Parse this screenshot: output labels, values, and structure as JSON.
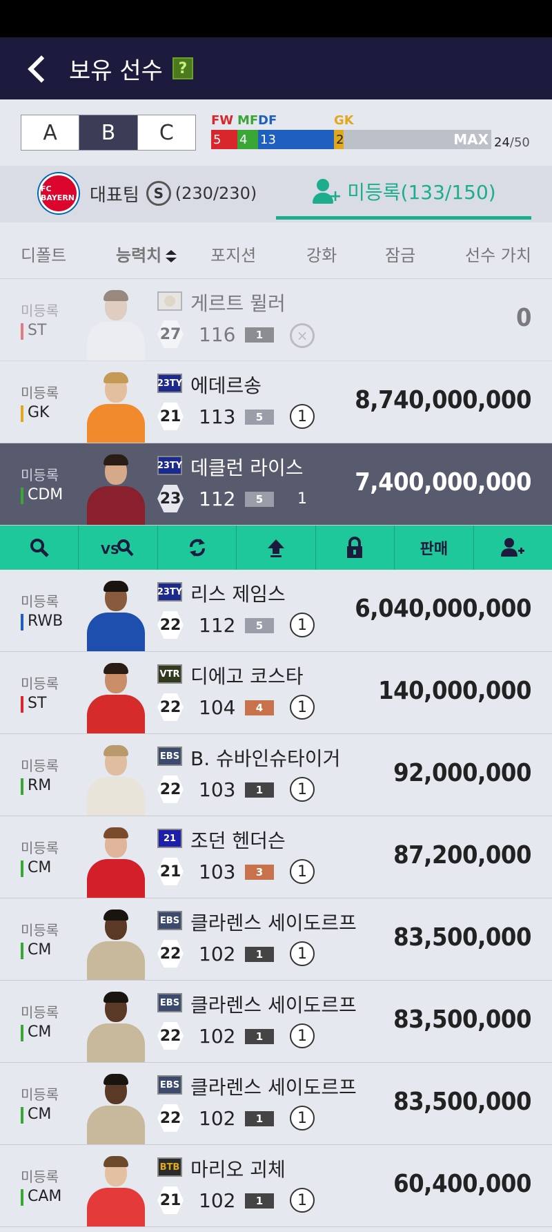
{
  "header": {
    "title": "보유 선수",
    "help": "?"
  },
  "squad_tabs": [
    "A",
    "B",
    "C"
  ],
  "positions": {
    "fw_label": "FW",
    "mf_label": "MF",
    "df_label": "DF",
    "gk_label": "GK",
    "fw": "5",
    "mf": "4",
    "df": "13",
    "gk": "2",
    "max_label": "MAX",
    "count": "24",
    "total": "/50",
    "colors": {
      "fw": "#d9262c",
      "mf": "#3aa635",
      "df": "#1f5fbf",
      "gk": "#e0a91b"
    }
  },
  "team_tabs": {
    "crest_text": "FC BAYERN",
    "team_label": "대표팀",
    "s_badge": "S",
    "team_count": "(230/230)",
    "unregistered_label": "미등록(133/150)"
  },
  "sort": [
    "디폴트",
    "능력치",
    "포지션",
    "강화",
    "잠금",
    "선수 가치"
  ],
  "actions": {
    "sell_label": "판매"
  },
  "players": [
    {
      "status": "미등록",
      "position": "ST",
      "pos_color": "#d9262c",
      "season": "",
      "season_color": "#e0e0e0",
      "name": "게르트 뮐러",
      "age": "27",
      "ovr": "116",
      "grade": "1",
      "grade_color": "#444",
      "enhance": "",
      "value": "0"
    },
    {
      "status": "미등록",
      "position": "GK",
      "pos_color": "#e0a91b",
      "season": "23TY",
      "season_color": "#1b2a8c",
      "name": "에데르송",
      "age": "21",
      "ovr": "113",
      "grade": "5",
      "grade_color": "#9a9ea8",
      "enhance": "1",
      "value": "8,740,000,000"
    },
    {
      "status": "미등록",
      "position": "CDM",
      "pos_color": "#3aa635",
      "season": "23TY",
      "season_color": "#1b2a8c",
      "name": "데클런 라이스",
      "age": "23",
      "ovr": "112",
      "grade": "5",
      "grade_color": "#9a9ea8",
      "enhance": "1",
      "value": "7,400,000,000"
    },
    {
      "status": "미등록",
      "position": "RWB",
      "pos_color": "#1f5fbf",
      "season": "23TY",
      "season_color": "#1b2a8c",
      "name": "리스 제임스",
      "age": "22",
      "ovr": "112",
      "grade": "5",
      "grade_color": "#9a9ea8",
      "enhance": "1",
      "value": "6,040,000,000"
    },
    {
      "status": "미등록",
      "position": "ST",
      "pos_color": "#d9262c",
      "season": "VTR",
      "season_color": "#2f3a1e",
      "name": "디에고 코스타",
      "age": "22",
      "ovr": "104",
      "grade": "4",
      "grade_color": "#c9714a",
      "enhance": "1",
      "value": "140,000,000"
    },
    {
      "status": "미등록",
      "position": "RM",
      "pos_color": "#3aa635",
      "season": "EBS",
      "season_color": "#3c4a6e",
      "name": "B. 슈바인슈타이거",
      "age": "22",
      "ovr": "103",
      "grade": "1",
      "grade_color": "#444",
      "enhance": "1",
      "value": "92,000,000"
    },
    {
      "status": "미등록",
      "position": "CM",
      "pos_color": "#3aa635",
      "season": "21",
      "season_color": "#1d1fa8",
      "name": "조던 헨더슨",
      "age": "21",
      "ovr": "103",
      "grade": "3",
      "grade_color": "#c9714a",
      "enhance": "1",
      "value": "87,200,000"
    },
    {
      "status": "미등록",
      "position": "CM",
      "pos_color": "#3aa635",
      "season": "EBS",
      "season_color": "#3c4a6e",
      "name": "클라렌스 세이도르프",
      "age": "22",
      "ovr": "102",
      "grade": "1",
      "grade_color": "#444",
      "enhance": "1",
      "value": "83,500,000"
    },
    {
      "status": "미등록",
      "position": "CM",
      "pos_color": "#3aa635",
      "season": "EBS",
      "season_color": "#3c4a6e",
      "name": "클라렌스 세이도르프",
      "age": "22",
      "ovr": "102",
      "grade": "1",
      "grade_color": "#444",
      "enhance": "1",
      "value": "83,500,000"
    },
    {
      "status": "미등록",
      "position": "CM",
      "pos_color": "#3aa635",
      "season": "EBS",
      "season_color": "#3c4a6e",
      "name": "클라렌스 세이도르프",
      "age": "22",
      "ovr": "102",
      "grade": "1",
      "grade_color": "#444",
      "enhance": "1",
      "value": "83,500,000"
    },
    {
      "status": "미등록",
      "position": "CAM",
      "pos_color": "#3aa635",
      "season": "BTB",
      "season_color": "#2a2a2a",
      "name": "마리오 괴체",
      "age": "21",
      "ovr": "102",
      "grade": "1",
      "grade_color": "#444",
      "enhance": "1",
      "value": "60,400,000"
    }
  ]
}
